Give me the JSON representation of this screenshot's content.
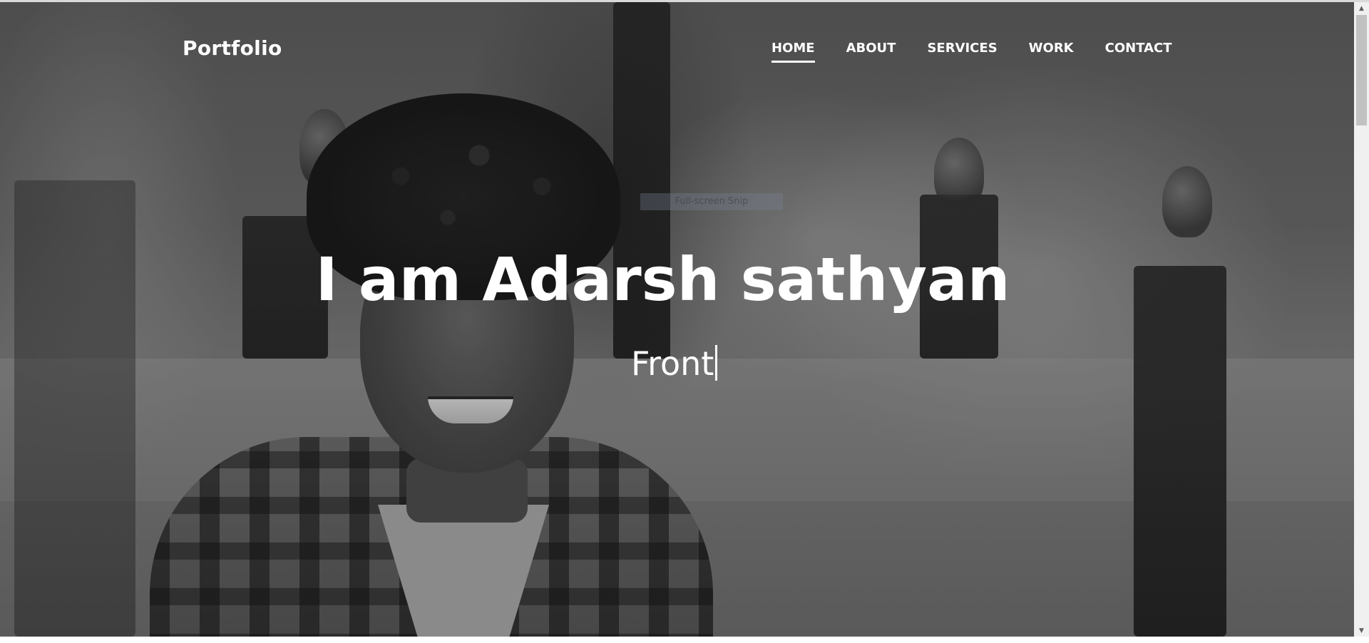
{
  "header": {
    "logo": "Portfolio",
    "nav": [
      {
        "label": "HOME",
        "active": true
      },
      {
        "label": "ABOUT",
        "active": false
      },
      {
        "label": "SERVICES",
        "active": false
      },
      {
        "label": "WORK",
        "active": false
      },
      {
        "label": "CONTACT",
        "active": false
      }
    ]
  },
  "hero": {
    "title": "I am Adarsh sathyan",
    "typed_text": "Front"
  },
  "overlay_tooltip": "Full-screen Snip",
  "colors": {
    "text": "#ffffff",
    "photo_tone": "grayscale"
  },
  "icons": {
    "scroll_up": "chevron-up-icon",
    "scroll_down": "chevron-down-icon"
  }
}
